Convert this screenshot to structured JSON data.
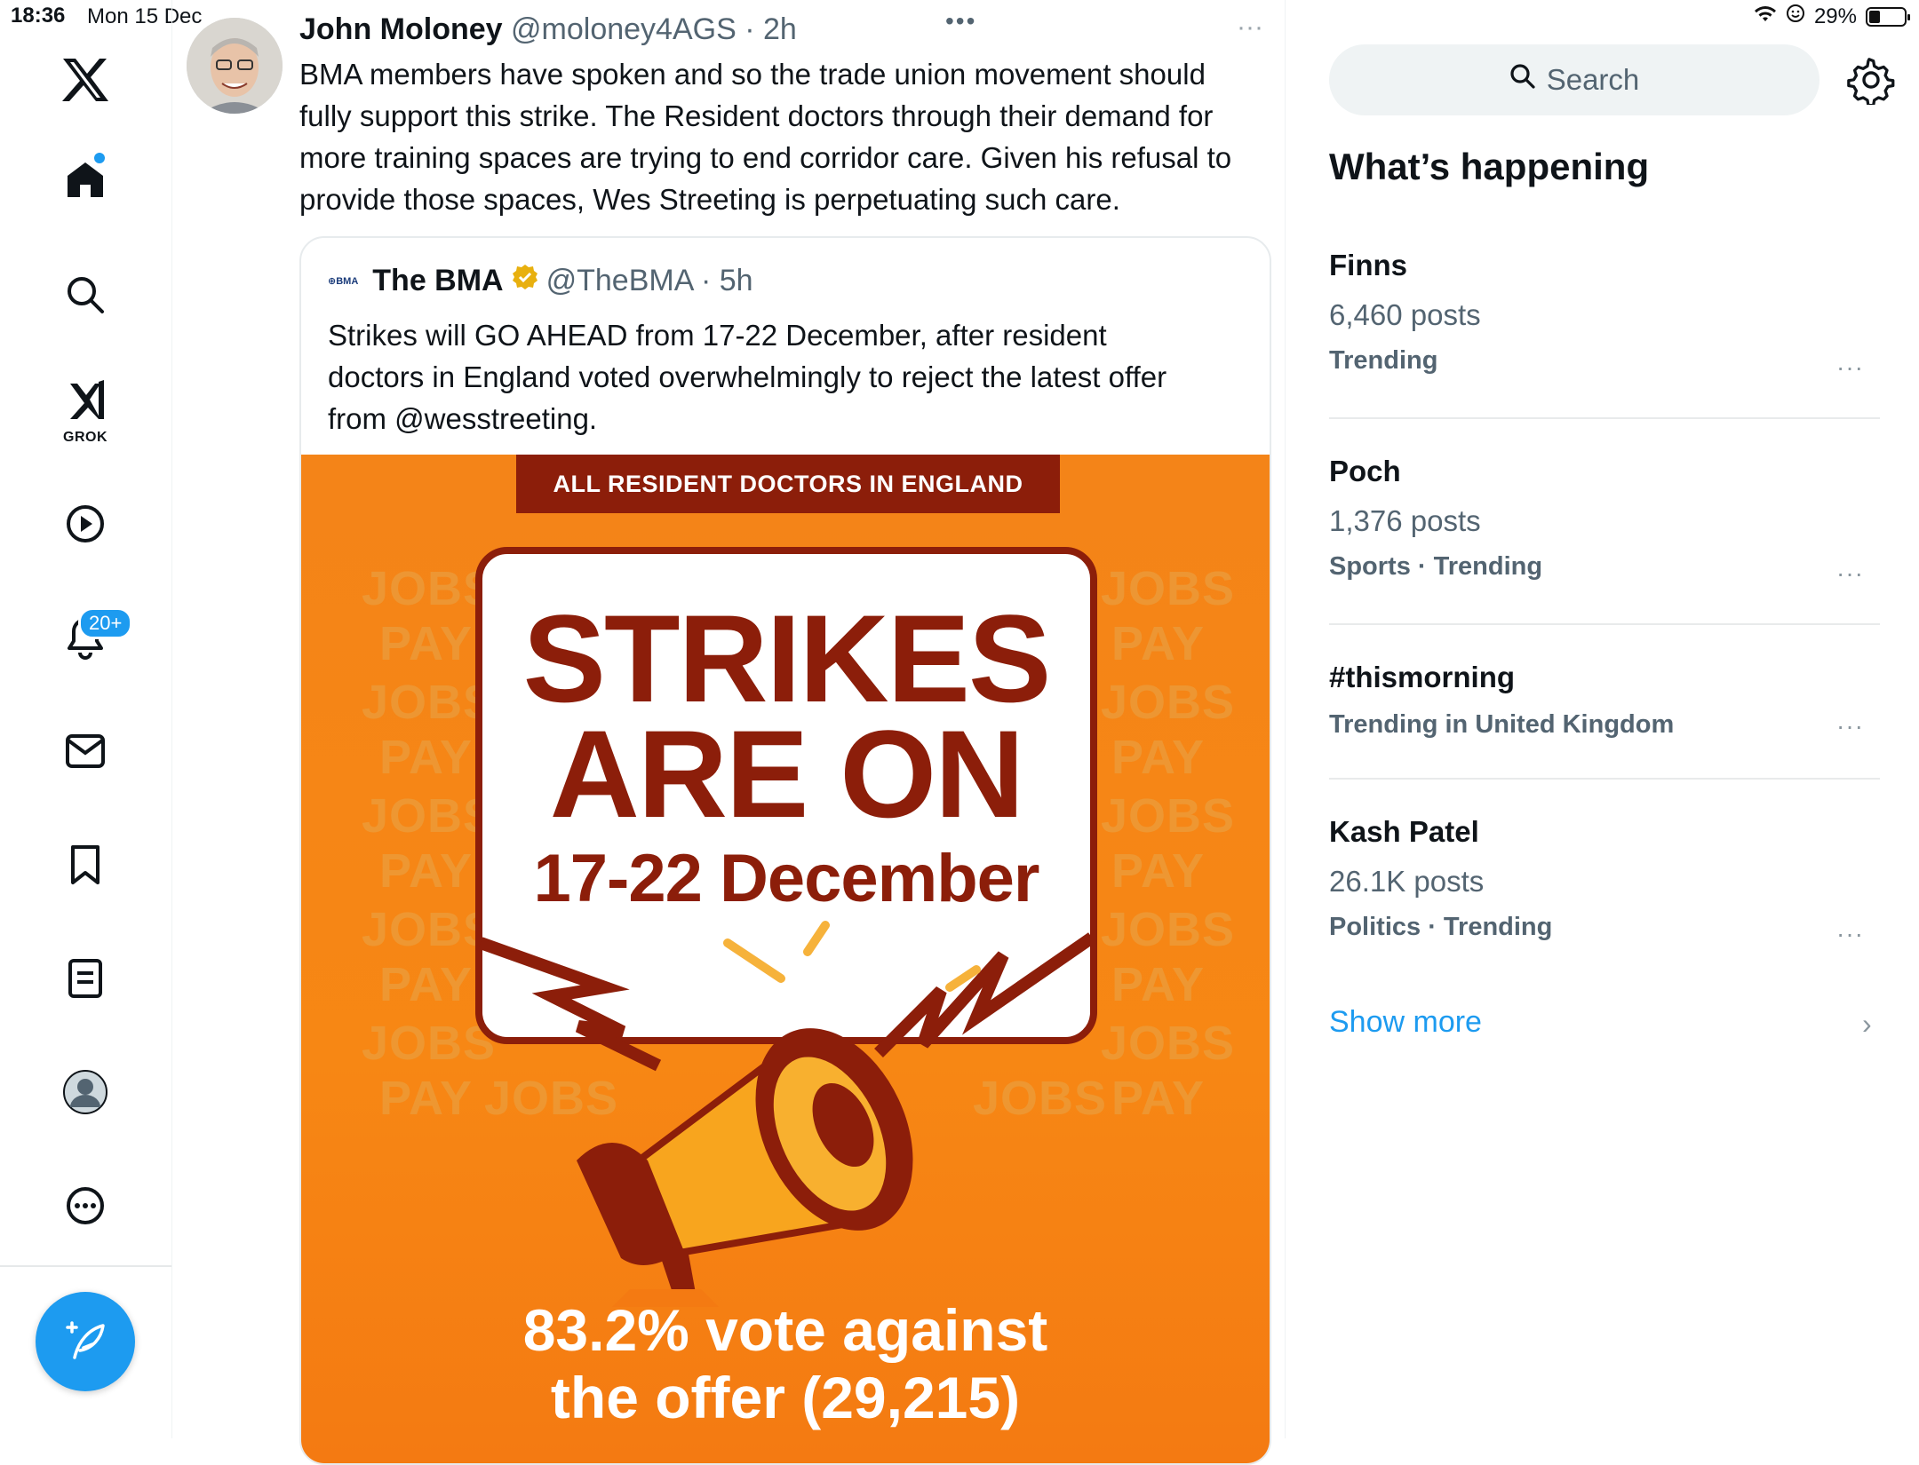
{
  "status_bar": {
    "time": "18:36",
    "date": "Mon 15 Dec",
    "battery": "29%"
  },
  "sidebar": {
    "notifications_badge": "20+",
    "grok_label": "GROK"
  },
  "feed": {
    "overflow": "•••",
    "tweet": {
      "author_name": "John Moloney",
      "author_meta": "@moloney4AGS · 2h",
      "more": "···",
      "text": "BMA members have spoken and so the  trade union movement should\nfully support this strike. The Resident doctors through their demand for\nmore training spaces are trying to end corridor care. Given his refusal to\nprovide those spaces, Wes Streeting is perpetuating such care."
    },
    "quote": {
      "logo_text": "⊕BMA",
      "author_name": "The BMA",
      "author_meta": "@TheBMA · 5h",
      "text": "Strikes will GO AHEAD from 17-22 December, after resident\ndoctors in England voted overwhelmingly to reject the latest offer\nfrom @wesstreeting.",
      "poster": {
        "banner": "ALL RESIDENT DOCTORS IN ENGLAND",
        "line1": "STRIKES",
        "line2": "ARE ON",
        "line3": "17-22 December",
        "foot1": "83.2% vote against",
        "foot2": "the offer (29,215)",
        "bg_word_jobs": "JOBS",
        "bg_word_pay": "PAY"
      }
    }
  },
  "right_panel": {
    "search_placeholder": "Search",
    "section_title": "What’s happening",
    "trends": [
      {
        "name": "Finns",
        "posts": "6,460 posts",
        "category": "Trending",
        "more": "···"
      },
      {
        "name": "Poch",
        "posts": "1,376 posts",
        "category": "Sports · Trending",
        "more": "···"
      },
      {
        "name": "#thismorning",
        "posts": "",
        "category": "Trending in United Kingdom",
        "more": "···"
      },
      {
        "name": "Kash Patel",
        "posts": "26.1K posts",
        "category": "Politics · Trending",
        "more": "···"
      }
    ],
    "show_more": "Show more",
    "chevron": "›"
  },
  "colors": {
    "accent": "#1d9bf0",
    "poster_orange": "#f78714",
    "poster_maroon": "#8c1e0a",
    "verified_gold": "#e8b00f"
  }
}
